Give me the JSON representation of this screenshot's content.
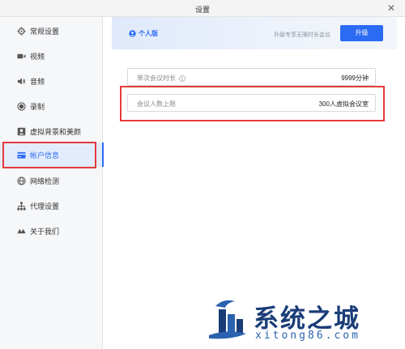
{
  "window": {
    "title": "设置",
    "close_label": "✕"
  },
  "sidebar": {
    "items": [
      {
        "label": "常规设置",
        "icon": "gear-icon",
        "active": false
      },
      {
        "label": "视频",
        "icon": "video-camera-icon",
        "active": false
      },
      {
        "label": "音频",
        "icon": "speaker-icon",
        "active": false
      },
      {
        "label": "录制",
        "icon": "record-icon",
        "active": false
      },
      {
        "label": "虚拟背景和美颜",
        "icon": "portrait-icon",
        "active": false
      },
      {
        "label": "帐户信息",
        "icon": "card-icon",
        "active": true
      },
      {
        "label": "网络检测",
        "icon": "globe-icon",
        "active": false
      },
      {
        "label": "代理设置",
        "icon": "network-icon",
        "active": false
      },
      {
        "label": "关于我们",
        "icon": "logo-icon",
        "active": false
      }
    ]
  },
  "account": {
    "plan_label": "个人版",
    "upgrade_tip": "升级专享无限时长会议",
    "upgrade_button": "升级",
    "rows": [
      {
        "key": "单次会议时长",
        "value": "9999分钟",
        "has_info": true
      },
      {
        "key": "会议人数上限",
        "value": "300人虚拟会议室",
        "has_info": false
      }
    ]
  },
  "watermark": {
    "title": "系统之城",
    "subtitle": "xitong86.com"
  },
  "colors": {
    "accent": "#2b6bf3",
    "highlight": "#e33b3b",
    "sidebar_bg": "#f6f7f9"
  }
}
